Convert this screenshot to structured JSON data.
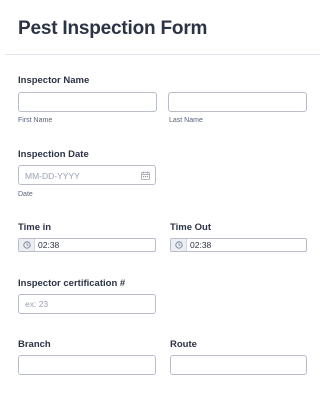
{
  "form": {
    "title": "Pest Inspection Form"
  },
  "inspector_name": {
    "label": "Inspector Name",
    "first_sublabel": "First Name",
    "last_sublabel": "Last Name",
    "first_value": "",
    "last_value": ""
  },
  "inspection_date": {
    "label": "Inspection Date",
    "placeholder": "MM-DD-YYYY",
    "sublabel": "Date",
    "icon": "calendar-icon"
  },
  "time_in": {
    "label": "Time in",
    "value": "02:38",
    "icon": "clock-icon"
  },
  "time_out": {
    "label": "Time Out",
    "value": "02:38",
    "icon": "clock-icon"
  },
  "certification": {
    "label": "Inspector certification #",
    "placeholder": "ex: 23"
  },
  "branch": {
    "label": "Branch",
    "value": ""
  },
  "route": {
    "label": "Route",
    "value": ""
  },
  "colors": {
    "text": "#2c3345",
    "border": "#b8bdc9",
    "placeholder": "#9aa1b2",
    "divider": "#e3e5ec"
  }
}
